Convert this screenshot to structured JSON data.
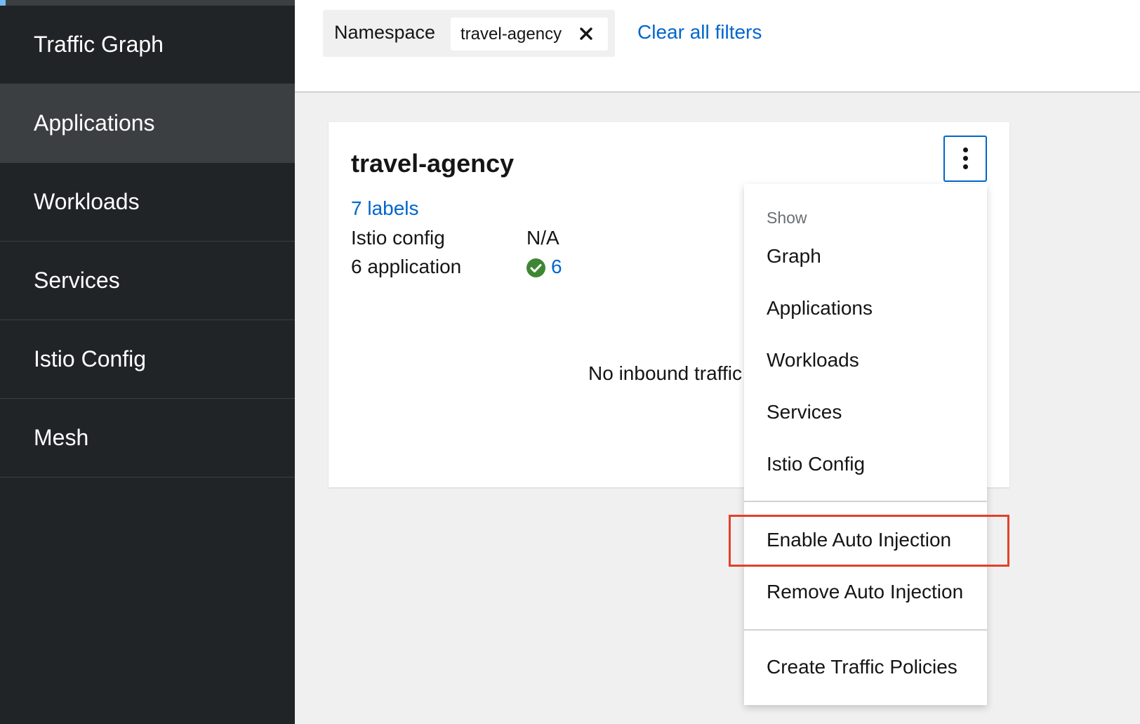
{
  "sidebar": {
    "items": [
      {
        "label": "Traffic Graph",
        "active": false
      },
      {
        "label": "Applications",
        "active": true
      },
      {
        "label": "Workloads",
        "active": false
      },
      {
        "label": "Services",
        "active": false
      },
      {
        "label": "Istio Config",
        "active": false
      },
      {
        "label": "Mesh",
        "active": false
      }
    ]
  },
  "filter": {
    "category": "Namespace",
    "chip": "travel-agency",
    "chip_close_icon": "close-icon",
    "clear_all": "Clear all filters"
  },
  "card": {
    "title": "travel-agency",
    "labels_link": "7 labels",
    "istio_config_label": "Istio config",
    "istio_config_value": "N/A",
    "applications_label": "6 application",
    "applications_status_icon": "check-circle-icon",
    "applications_status_color": "#3e8635",
    "applications_count": "6",
    "no_traffic": "No inbound traffic"
  },
  "menu": {
    "group_title": "Show",
    "show_items": [
      "Graph",
      "Applications",
      "Workloads",
      "Services",
      "Istio Config"
    ],
    "injection_items": [
      "Enable Auto Injection",
      "Remove Auto Injection"
    ],
    "policy_items": [
      "Create Traffic Policies"
    ],
    "highlighted_item": "Enable Auto Injection",
    "highlight_color": "#e2402b"
  }
}
